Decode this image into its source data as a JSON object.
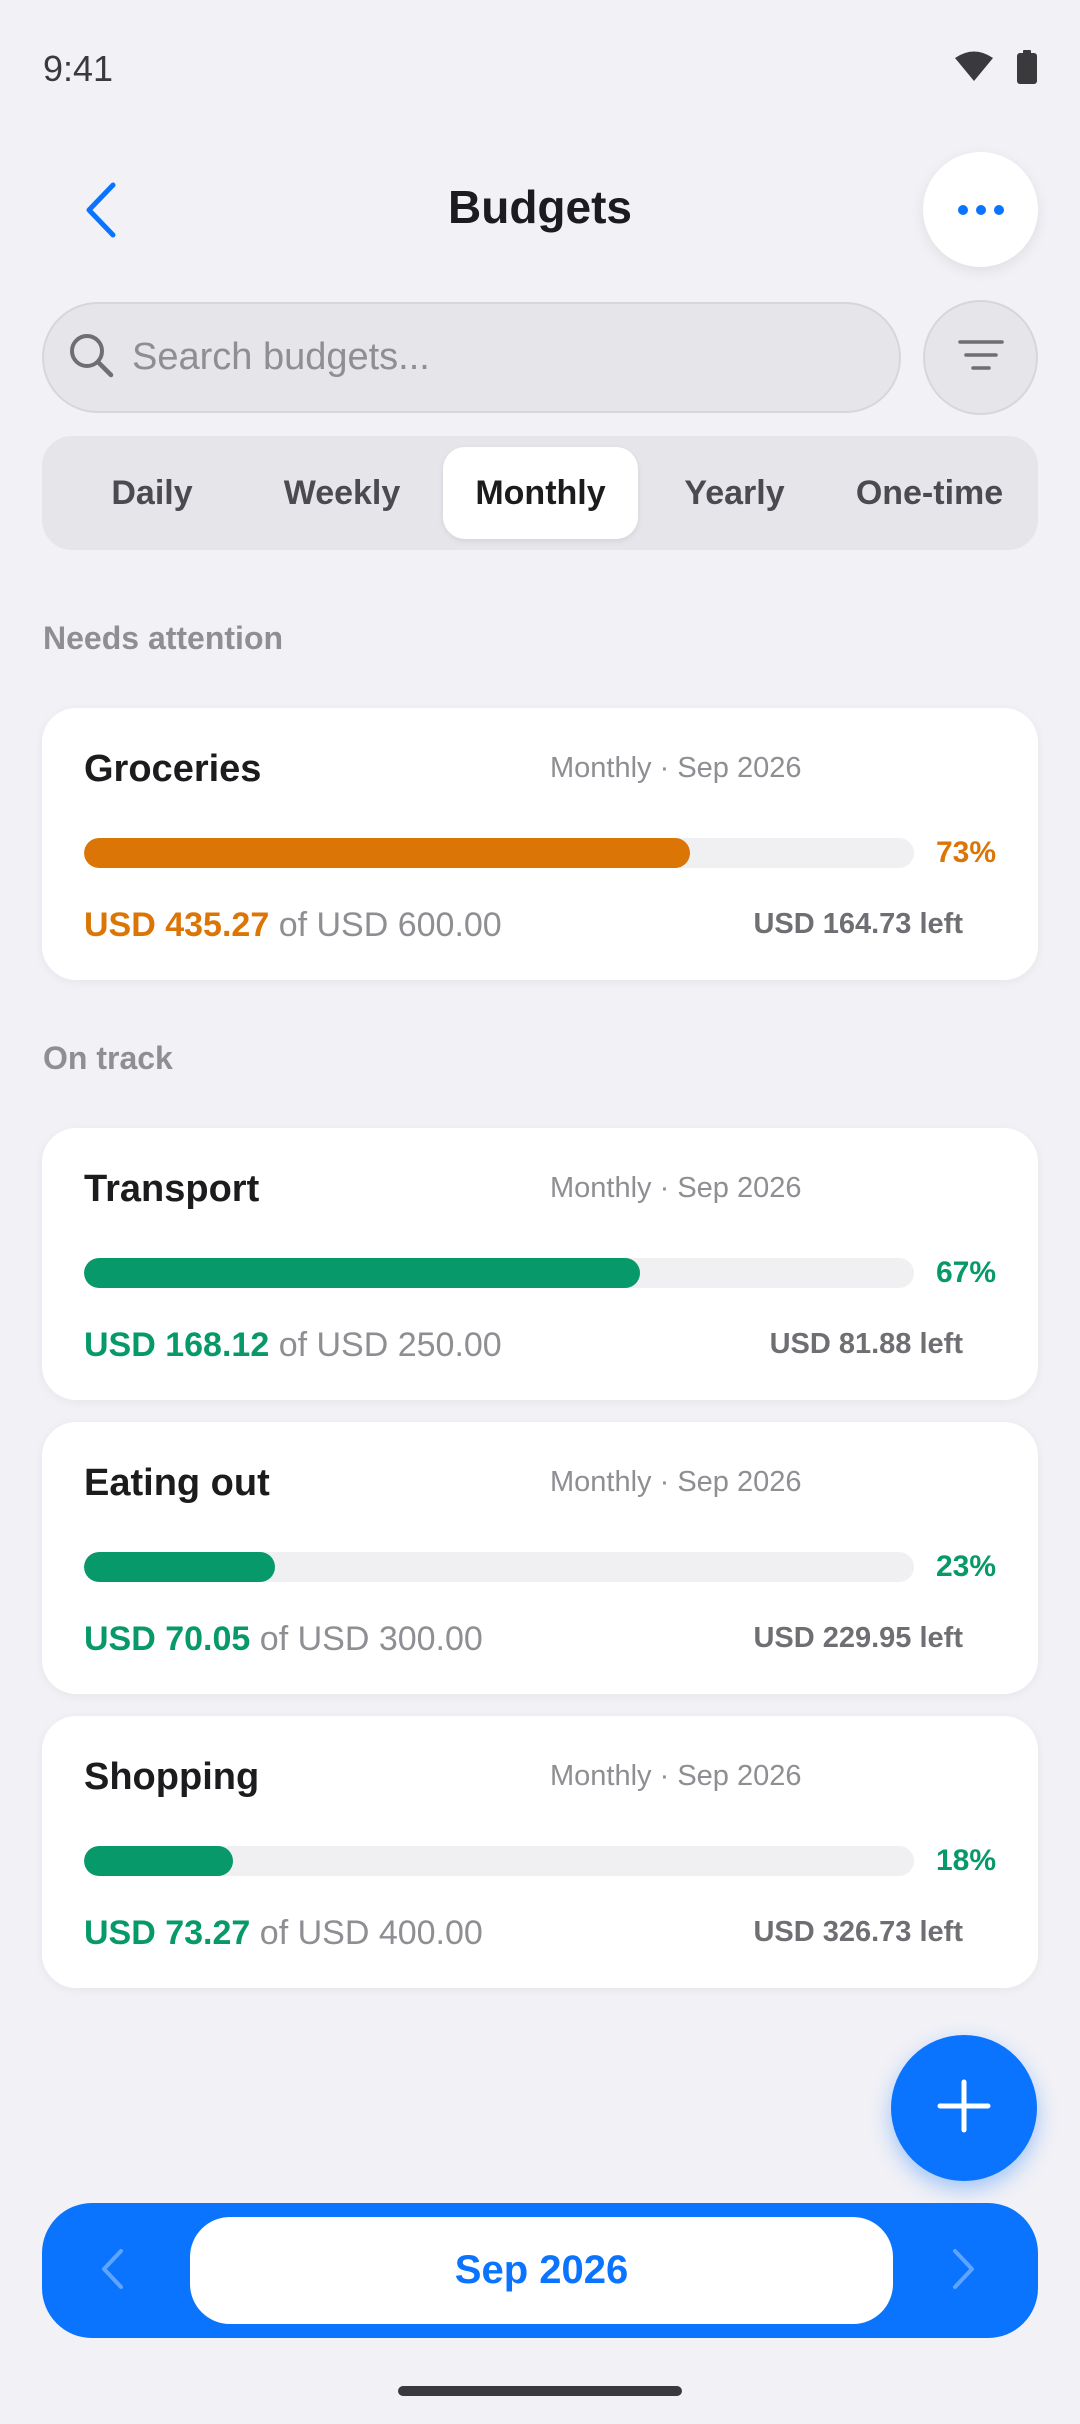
{
  "status_bar": {
    "time": "9:41"
  },
  "header": {
    "title": "Budgets"
  },
  "search": {
    "placeholder": "Search budgets..."
  },
  "tabs": [
    {
      "label": "Daily",
      "active": false
    },
    {
      "label": "Weekly",
      "active": false
    },
    {
      "label": "Monthly",
      "active": true
    },
    {
      "label": "Yearly",
      "active": false
    },
    {
      "label": "One-time",
      "active": false
    }
  ],
  "sections": {
    "needs_attention": "Needs attention",
    "on_track": "On track"
  },
  "budgets": [
    {
      "name": "Groceries",
      "period": "Monthly · Sep 2026",
      "percent_label": "73%",
      "progress": 0.73,
      "spent": "USD 435.27",
      "of_total": "of USD 600.00",
      "left": "USD 164.73 left",
      "status_color": "#DB7505"
    },
    {
      "name": "Transport",
      "period": "Monthly · Sep 2026",
      "percent_label": "67%",
      "progress": 0.67,
      "spent": "USD 168.12",
      "of_total": "of USD 250.00",
      "left": "USD 81.88 left",
      "status_color": "#07996A"
    },
    {
      "name": "Eating out",
      "period": "Monthly · Sep 2026",
      "percent_label": "23%",
      "progress": 0.23,
      "spent": "USD 70.05",
      "of_total": "of USD 300.00",
      "left": "USD 229.95 left",
      "status_color": "#07996A"
    },
    {
      "name": "Shopping",
      "period": "Monthly · Sep 2026",
      "percent_label": "18%",
      "progress": 0.18,
      "spent": "USD 73.27",
      "of_total": "of USD 400.00",
      "left": "USD 326.73 left",
      "status_color": "#07996A"
    }
  ],
  "month_nav": {
    "label": "Sep 2026"
  },
  "colors": {
    "accent": "#0A74FF",
    "warning": "#DB7505",
    "ok": "#07996A"
  }
}
